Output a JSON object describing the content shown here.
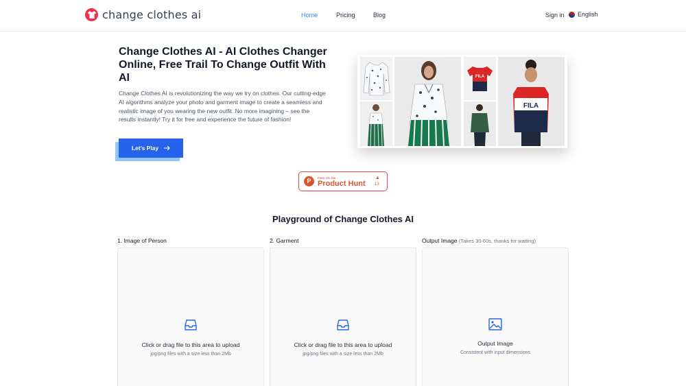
{
  "brand": {
    "name": "change clothes ai"
  },
  "nav": {
    "home": "Home",
    "pricing": "Pricing",
    "blog": "Blog"
  },
  "account": {
    "signin": "Sign in",
    "language": "English"
  },
  "hero": {
    "title": "Change Clothes AI - AI Clothes Changer Online, Free Trail To Change Outfit With AI",
    "description": "Change Clothes AI is revolutionizing the way we try on clothes. Our cutting-edge AI algorithms analyze your photo and garment image to create a seamless and realistic image of you wearing the new outfit. No more imagining – see the results instantly! Try it for free and experience the future of fashion!",
    "cta": "Let's Play",
    "cta_icon": "arrow-right-icon"
  },
  "product_hunt": {
    "small": "FIND US ON",
    "name": "Product Hunt",
    "votes": "13"
  },
  "playground": {
    "title": "Playground of Change Clothes AI",
    "person": {
      "label": "1. Image of Person",
      "main": "Click or drag file to this area to upload",
      "sub": "jpg/png files with a size less than 2Mb"
    },
    "garment": {
      "label": "2. Garment",
      "main": "Click or drag file to this area to upload",
      "sub": "jpg/png files with a size less than 2Mb"
    },
    "output": {
      "label": "Output Image",
      "note": "(Takes 30-60s, thanks for waiting)",
      "main": "Output Image",
      "sub": "Consistent with input dimensions"
    }
  },
  "colors": {
    "accent": "#2563eb",
    "brand": "#e8344e",
    "product_hunt": "#da552f",
    "active_nav": "#3b82f6"
  }
}
